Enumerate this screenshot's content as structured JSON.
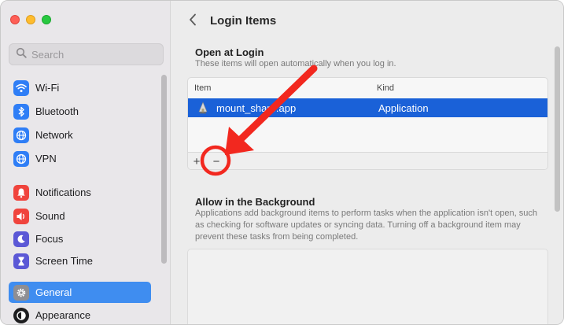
{
  "window": {
    "traffic_lights": [
      "close",
      "minimize",
      "zoom"
    ]
  },
  "sidebar": {
    "search_placeholder": "Search",
    "items": [
      {
        "label": "Wi-Fi",
        "icon": "wifi-icon",
        "color": "#2f7ef6"
      },
      {
        "label": "Bluetooth",
        "icon": "bluetooth-icon",
        "color": "#2f7ef6"
      },
      {
        "label": "Network",
        "icon": "globe-icon",
        "color": "#2f7ef6"
      },
      {
        "label": "VPN",
        "icon": "globe-icon",
        "color": "#2f7ef6"
      },
      {
        "label": "Notifications",
        "icon": "bell-icon",
        "color": "#f0443d"
      },
      {
        "label": "Sound",
        "icon": "speaker-icon",
        "color": "#f0443d"
      },
      {
        "label": "Focus",
        "icon": "moon-icon",
        "color": "#5b58d6"
      },
      {
        "label": "Screen Time",
        "icon": "hourglass-icon",
        "color": "#5b58d6"
      },
      {
        "label": "General",
        "icon": "gear-icon",
        "color": "#8e8e93",
        "selected": true
      },
      {
        "label": "Appearance",
        "icon": "appearance-icon",
        "color": "#1d1d1f"
      }
    ]
  },
  "header": {
    "back_label": "‹",
    "title": "Login Items"
  },
  "open_at_login": {
    "title": "Open at Login",
    "subtitle": "These items will open automatically when you log in.",
    "columns": {
      "item": "Item",
      "kind": "Kind"
    },
    "rows": [
      {
        "name": "mount_share.app",
        "kind": "Application",
        "selected": true
      }
    ],
    "add_label": "+",
    "remove_label": "−"
  },
  "allow_background": {
    "title": "Allow in the Background",
    "description": "Applications add background items to perform tasks when the application isn't open, such as checking for software updates or syncing data. Turning off a background item may prevent these tasks from being completed."
  },
  "colors": {
    "accent": "#1a61d8",
    "sidebar_selected": "#3f8df0",
    "annotation": "#f2281f"
  }
}
